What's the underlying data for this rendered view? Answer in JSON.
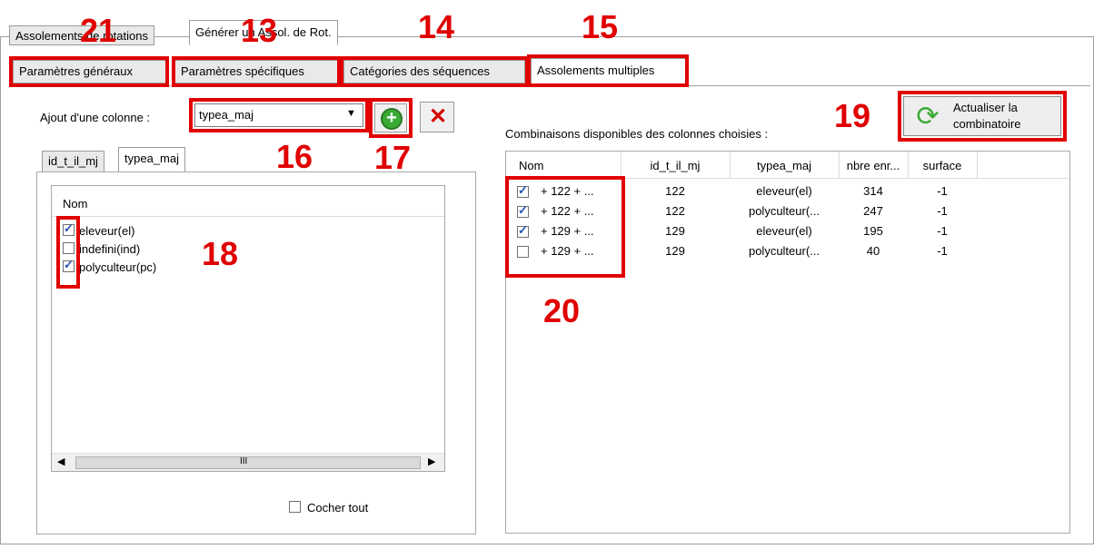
{
  "top_tabs": [
    "Assolements de rotations",
    "Générer un Assol. de Rot."
  ],
  "sub_tabs": [
    "Paramètres généraux",
    "Paramètres spécifiques",
    "Catégories des séquences",
    "Assolements multiples"
  ],
  "annotations": [
    "21",
    "13",
    "14",
    "15",
    "16",
    "17",
    "18",
    "19",
    "20"
  ],
  "left": {
    "add_column_label": "Ajout d'une colonne :",
    "add_column_value": "typea_maj",
    "col_tabs": [
      "id_t_il_mj",
      "typea_maj"
    ],
    "list_header": "Nom",
    "items": [
      {
        "label": "eleveur(el)",
        "checked": true
      },
      {
        "label": "indefini(ind)",
        "checked": false
      },
      {
        "label": "polyculteur(pc)",
        "checked": true
      }
    ],
    "scroll_thumb": "III",
    "check_all": "Cocher tout"
  },
  "right": {
    "title": "Combinaisons disponibles des colonnes choisies :",
    "refresh_label_1": "Actualiser la",
    "refresh_label_2": "combinatoire",
    "headers": [
      "Nom",
      "id_t_il_mj",
      "typea_maj",
      "nbre enr...",
      "surface"
    ],
    "rows": [
      {
        "checked": true,
        "nom": "+ 122 + ...",
        "id": "122",
        "type": "eleveur(el)",
        "nbre": "314",
        "surface": "-1"
      },
      {
        "checked": true,
        "nom": "+ 122 + ...",
        "id": "122",
        "type": "polyculteur(...",
        "nbre": "247",
        "surface": "-1"
      },
      {
        "checked": true,
        "nom": "+ 129 + ...",
        "id": "129",
        "type": "eleveur(el)",
        "nbre": "195",
        "surface": "-1"
      },
      {
        "checked": false,
        "nom": "+ 129 + ...",
        "id": "129",
        "type": "polyculteur(...",
        "nbre": "40",
        "surface": "-1"
      }
    ]
  },
  "colors": {
    "annotation": "#e00000",
    "add_button": "#3aaa35",
    "delete_icon": "#d40000"
  }
}
